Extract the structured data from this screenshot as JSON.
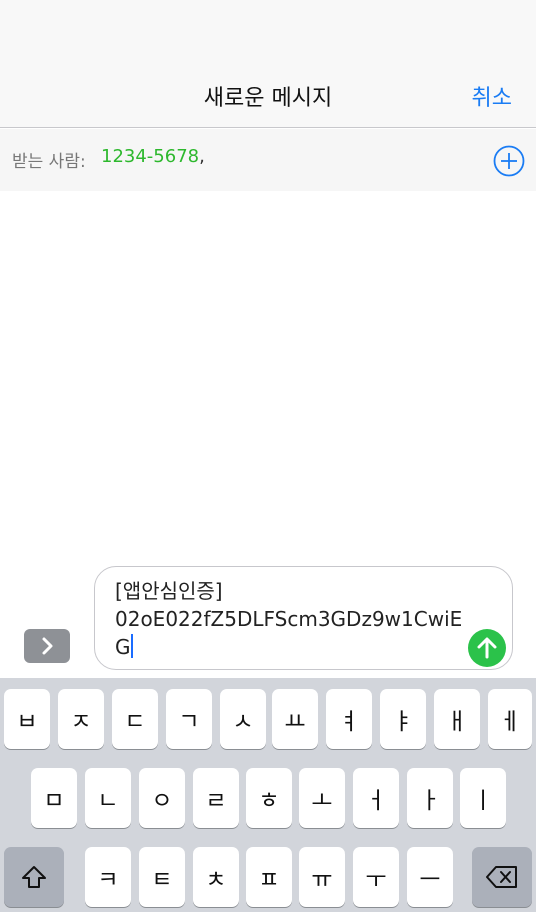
{
  "header": {
    "title": "새로운 메시지",
    "cancel_label": "취소"
  },
  "recipient": {
    "label": "받는 사람:",
    "value": "1234-5678",
    "separator": ","
  },
  "composer": {
    "text": "[앱안심인증]\n02oE022fZ5DLFScm3GDz9w1CwiEG"
  },
  "keyboard": {
    "row1": [
      "ㅂ",
      "ㅈ",
      "ㄷ",
      "ㄱ",
      "ㅅ",
      "ㅛ",
      "ㅕ",
      "ㅑ",
      "ㅐ",
      "ㅔ"
    ],
    "row2": [
      "ㅁ",
      "ㄴ",
      "ㅇ",
      "ㄹ",
      "ㅎ",
      "ㅗ",
      "ㅓ",
      "ㅏ",
      "ㅣ"
    ],
    "row3": [
      "ㅋ",
      "ㅌ",
      "ㅊ",
      "ㅍ",
      "ㅠ",
      "ㅜ",
      "ㅡ"
    ]
  },
  "colors": {
    "accent": "#1a7cf4",
    "send": "#2bc24a",
    "recipient": "#2db82d"
  }
}
